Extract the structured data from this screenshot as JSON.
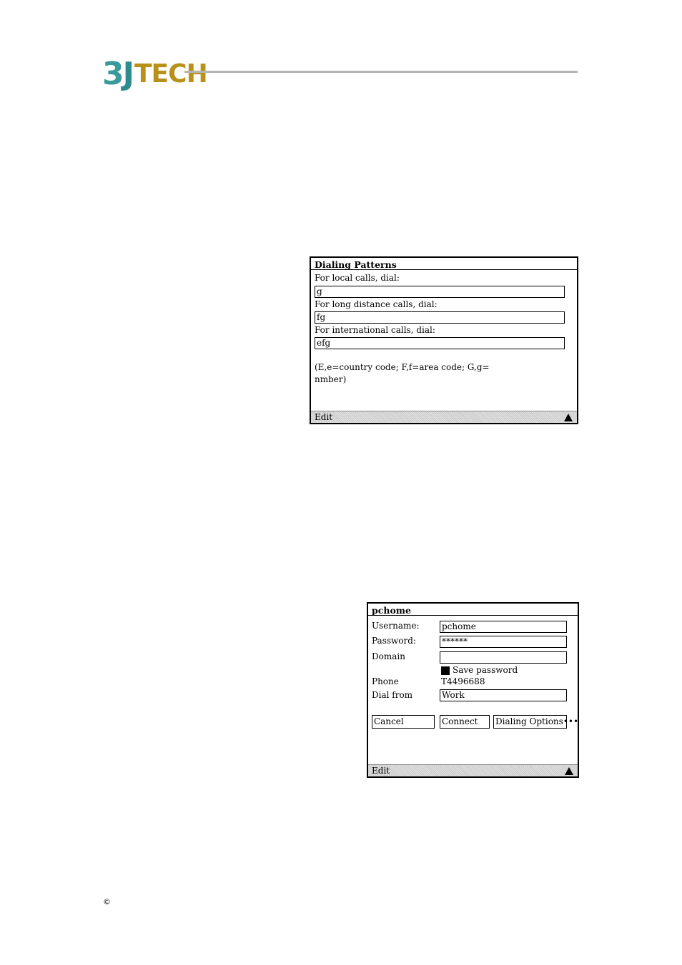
{
  "header": {
    "logo": {
      "mark_3": "3",
      "mark_j": "J",
      "mark_tech": "TECH"
    }
  },
  "dialing_patterns": {
    "title": "Dialing Patterns",
    "local_label": "For local calls, dial:",
    "local_value": "g",
    "long_distance_label": "For long distance calls, dial:",
    "long_distance_value": "fg",
    "international_label": "For international calls, dial:",
    "international_value": "efg",
    "note_line1": "(E,e=country code; F,f=area code; G,g=",
    "note_line2": "nmber)",
    "menu_label": "Edit"
  },
  "connect_dialog": {
    "title": "pchome",
    "username_label": "Username:",
    "username_value": "pchome",
    "password_label": "Password:",
    "password_value": "******",
    "domain_label": "Domain",
    "domain_value": "",
    "save_password_label": "Save password",
    "phone_label": "Phone",
    "phone_value": "T4496688",
    "dial_from_label": "Dial from",
    "dial_from_value": "Work",
    "cancel_label": "Cancel",
    "connect_label": "Connect",
    "dialing_options_label": "Dialing Options•••",
    "menu_label": "Edit"
  },
  "footer": {
    "copyright": "©"
  },
  "colors": {
    "logo_teal": "#3a9a9a",
    "logo_gold": "#b8901a",
    "rule_gray": "#b4b4b4"
  }
}
